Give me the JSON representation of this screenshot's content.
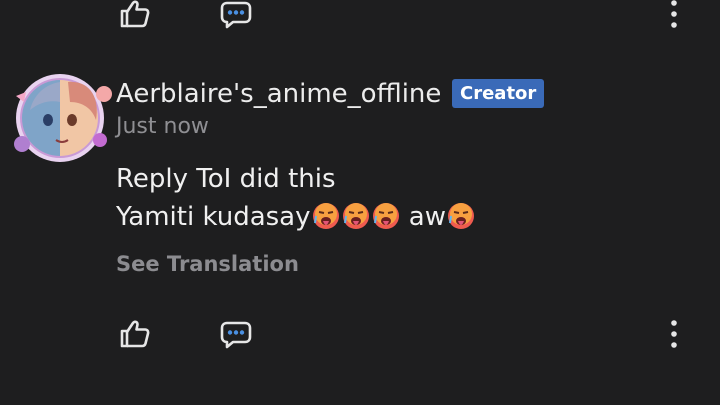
{
  "comment": {
    "username": "Aerblaire's_anime_offline",
    "badge": "Creator",
    "timestamp": "Just now",
    "line1": "Reply ToI did this",
    "line2_part1": "Yamiti kudasay",
    "line2_part2": " aw",
    "see_translation": "See Translation"
  },
  "icons": {
    "like": "thumbs-up-icon",
    "reply": "chat-bubble-icon",
    "more": "vertical-dots-icon",
    "emoji": "drooling-hot-face-emoji"
  },
  "colors": {
    "background": "#1e1e1f",
    "badge": "#3a6ab8",
    "icon_blue": "#4a90e2",
    "muted_text": "#8f8f93"
  }
}
